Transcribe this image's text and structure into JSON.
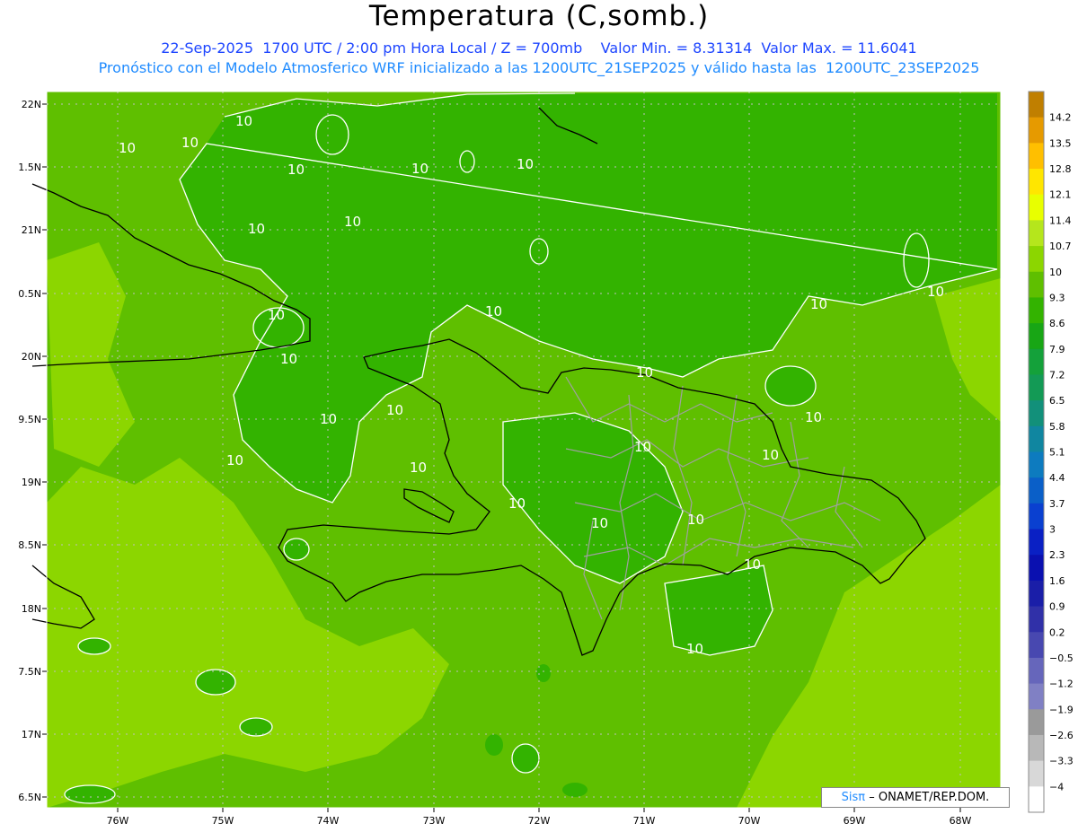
{
  "title": "Temperatura (C,somb.)",
  "subtitle_line1": "22-Sep-2025  1700 UTC / 2:00 pm Hora Local / Z = 700mb    Valor Min. = 8.31314  Valor Max. = 11.6041",
  "subtitle_line2": "Pronóstico con el Modelo Atmosferico WRF inicializado a las 1200UTC_21SEP2025 y válido hasta las  1200UTC_23SEP2025",
  "lat_labels": [
    "22N",
    "1.5N",
    "21N",
    "0.5N",
    "20N",
    "9.5N",
    "19N",
    "8.5N",
    "18N",
    "7.5N",
    "17N",
    "6.5N"
  ],
  "lon_labels": [
    "76W",
    "75W",
    "74W",
    "73W",
    "72W",
    "71W",
    "70W",
    "69W",
    "68W"
  ],
  "contour_label": "10",
  "colorbar": {
    "labels": [
      "14.2",
      "13.5",
      "12.8",
      "12.1",
      "11.4",
      "10.7",
      "10",
      "9.3",
      "8.6",
      "7.9",
      "7.2",
      "6.5",
      "5.8",
      "5.1",
      "4.4",
      "3.7",
      "3",
      "2.3",
      "1.6",
      "0.9",
      "0.2",
      "−0.5",
      "−1.2",
      "−1.9",
      "−2.6",
      "−3.3",
      "−4"
    ],
    "colors": [
      "#c07f00",
      "#e69a00",
      "#ffbf00",
      "#ffe600",
      "#e8ff00",
      "#b5e61c",
      "#8cd600",
      "#5fbf00",
      "#33b300",
      "#18a615",
      "#14a13a",
      "#139a55",
      "#12907a",
      "#1086a0",
      "#0d7bbf",
      "#0a5fc8",
      "#0a40d0",
      "#0a20c4",
      "#0a10b0",
      "#1a1ea8",
      "#3030a8",
      "#4848b0",
      "#6666bb",
      "#8080c4",
      "#9a9a9a",
      "#b8b8b8",
      "#d8d8d8",
      "#ffffff"
    ]
  },
  "credit": {
    "sis": "Sisπ",
    "org": "– ONAMET/REP.DOM."
  }
}
